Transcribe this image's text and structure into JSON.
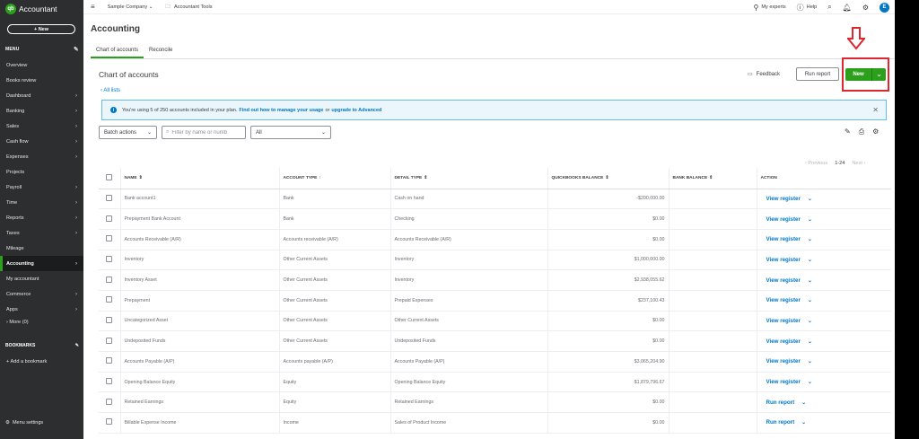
{
  "sidebar": {
    "brand": "Accountant",
    "new_label": "+ New",
    "menu_label": "MENU",
    "items": [
      {
        "label": "Overview",
        "chevron": false
      },
      {
        "label": "Books review",
        "chevron": false
      },
      {
        "label": "Dashboard",
        "chevron": true
      },
      {
        "label": "Banking",
        "chevron": true
      },
      {
        "label": "Sales",
        "chevron": true
      },
      {
        "label": "Cash flow",
        "chevron": true
      },
      {
        "label": "Expenses",
        "chevron": true
      },
      {
        "label": "Projects",
        "chevron": false
      },
      {
        "label": "Payroll",
        "chevron": true
      },
      {
        "label": "Time",
        "chevron": true
      },
      {
        "label": "Reports",
        "chevron": true
      },
      {
        "label": "Taxes",
        "chevron": true
      },
      {
        "label": "Mileage",
        "chevron": false
      },
      {
        "label": "Accounting",
        "chevron": true,
        "active": true
      },
      {
        "label": "My accountant",
        "chevron": false
      },
      {
        "label": "Commerce",
        "chevron": true
      },
      {
        "label": "Apps",
        "chevron": true
      }
    ],
    "more_label": "More (0)",
    "bookmarks_label": "BOOKMARKS",
    "add_bookmark_label": "+ Add a bookmark",
    "menu_settings_label": "Menu settings",
    "accent_color": "#2ca01c"
  },
  "topbar": {
    "company": "Sample Company",
    "tools": "Accountant Tools",
    "my_experts": "My experts",
    "help": "Help",
    "avatar_initial": "E"
  },
  "page": {
    "title": "Accounting",
    "tabs": [
      "Chart of accounts",
      "Reconcile"
    ],
    "section_title": "Chart of accounts",
    "feedback_label": "Feedback",
    "run_report_label": "Run report",
    "new_label": "New",
    "all_lists_label": "All lists",
    "banner": {
      "text": "You're using 5 of 250 accounts included in your plan.",
      "link1": "Find out how to manage your usage",
      "or": "or",
      "link2": "upgrade to Advanced"
    },
    "batch_actions_label": "Batch actions",
    "search_placeholder": "Filter by name or numb",
    "filter_select_value": "All",
    "pager": {
      "previous": "Previous",
      "range": "1-24",
      "next": "Next"
    },
    "highlight_color": "#e0262e"
  },
  "table": {
    "headers": {
      "name": "NAME",
      "type": "ACCOUNT TYPE",
      "detail": "DETAIL TYPE",
      "qb": "QUICKBOOKS BALANCE",
      "bank": "BANK BALANCE",
      "action": "ACTION"
    },
    "rows": [
      {
        "name": "Bank account1",
        "type": "Bank",
        "detail": "Cash on hand",
        "qb": "-$200,000.00",
        "bank": "",
        "action": "View register"
      },
      {
        "name": "Prepayment Bank Account",
        "type": "Bank",
        "detail": "Checking",
        "qb": "$0.00",
        "bank": "",
        "action": "View register"
      },
      {
        "name": "Accounts Receivable (A/R)",
        "type": "Accounts receivable (A/R)",
        "detail": "Accounts Receivable (A/R)",
        "qb": "$0.00",
        "bank": "",
        "action": "View register"
      },
      {
        "name": "Inventory",
        "type": "Other Current Assets",
        "detail": "Inventory",
        "qb": "$1,000,000.00",
        "bank": "",
        "action": "View register"
      },
      {
        "name": "Inventory Asset",
        "type": "Other Current Assets",
        "detail": "Inventory",
        "qb": "$2,938,055.62",
        "bank": "",
        "action": "View register"
      },
      {
        "name": "Prepayment",
        "type": "Other Current Assets",
        "detail": "Prepaid Expenses",
        "qb": "$237,100.43",
        "bank": "",
        "action": "View register"
      },
      {
        "name": "Uncategorized Asset",
        "type": "Other Current Assets",
        "detail": "Other Current Assets",
        "qb": "$0.00",
        "bank": "",
        "action": "View register"
      },
      {
        "name": "Undeposited Funds",
        "type": "Other Current Assets",
        "detail": "Undeposited Funds",
        "qb": "$0.00",
        "bank": "",
        "action": "View register"
      },
      {
        "name": "Accounts Payable (A/P)",
        "type": "Accounts payable (A/P)",
        "detail": "Accounts Payable (A/P)",
        "qb": "$3,065,204.90",
        "bank": "",
        "action": "View register"
      },
      {
        "name": "Opening Balance Equity",
        "type": "Equity",
        "detail": "Opening Balance Equity",
        "qb": "$1,879,796.67",
        "bank": "",
        "action": "View register"
      },
      {
        "name": "Retained Earnings",
        "type": "Equity",
        "detail": "Retained Earnings",
        "qb": "$0.00",
        "bank": "",
        "action": "Run report"
      },
      {
        "name": "Billable Expense Income",
        "type": "Income",
        "detail": "Sales of Product Income",
        "qb": "$0.00",
        "bank": "",
        "action": "Run report"
      }
    ]
  }
}
